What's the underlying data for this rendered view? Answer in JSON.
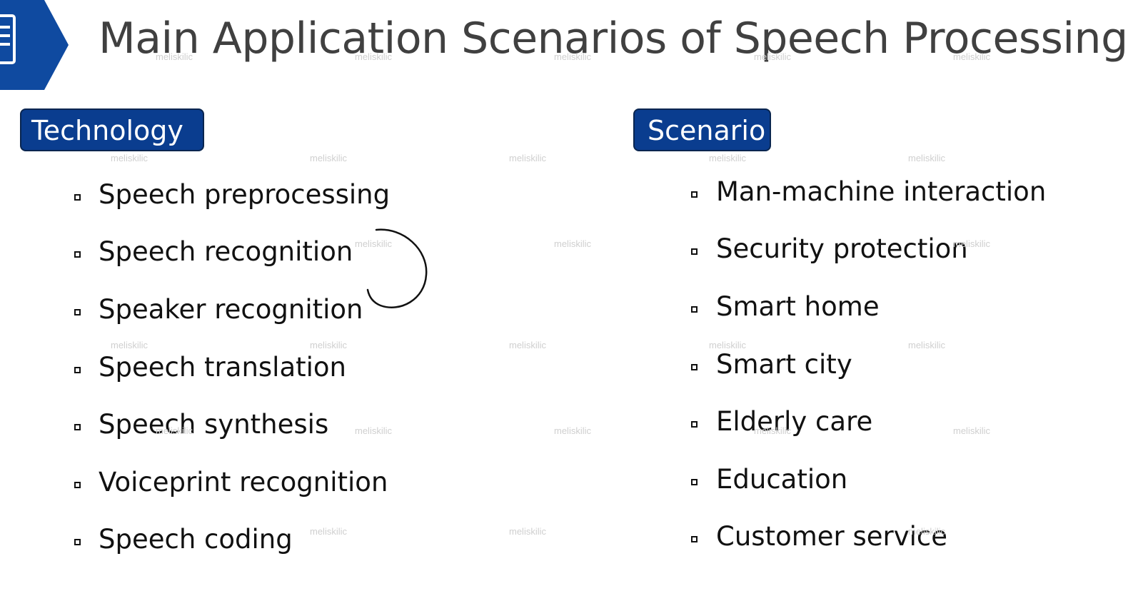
{
  "header": {
    "title": "Main Application Scenarios of Speech Processing",
    "emblem_icon": "document-list-icon",
    "accent_color": "#0a3d8f"
  },
  "technology": {
    "label": "Technology",
    "items": [
      "Speech preprocessing",
      "Speech recognition",
      "Speaker recognition",
      "Speech translation",
      "Speech synthesis",
      "Voiceprint recognition",
      "Speech coding"
    ]
  },
  "scenario": {
    "label": "Scenario",
    "items": [
      "Man-machine interaction",
      "Security protection",
      "Smart home",
      "Smart city",
      "Elderly care",
      "Education",
      "Customer service"
    ]
  },
  "watermark": {
    "text": "meliskilic"
  }
}
